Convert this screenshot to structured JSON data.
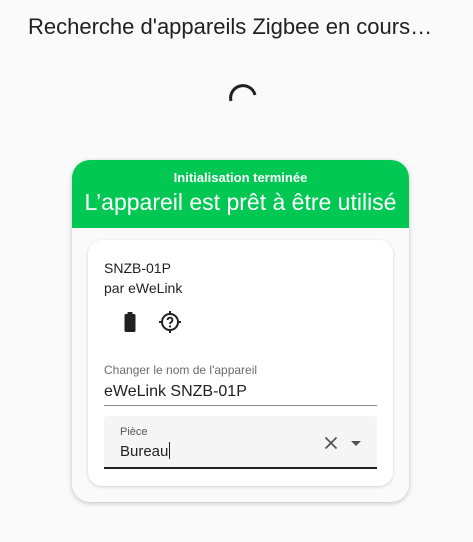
{
  "dialog": {
    "title": "Recherche d'appareils Zigbee en cours…"
  },
  "status_card": {
    "subtitle": "Initialisation terminée",
    "title": "L’appareil est prêt à être utilisé",
    "accent_color": "#00c853"
  },
  "device": {
    "model": "SNZB-01P",
    "manufacturer": "par eWeLink",
    "icons": [
      "battery-icon",
      "identify-icon"
    ]
  },
  "name_field": {
    "label": "Changer le nom de l'appareil",
    "value": "eWeLink SNZB-01P"
  },
  "room_field": {
    "label": "Pièce",
    "value": "Bureau"
  }
}
